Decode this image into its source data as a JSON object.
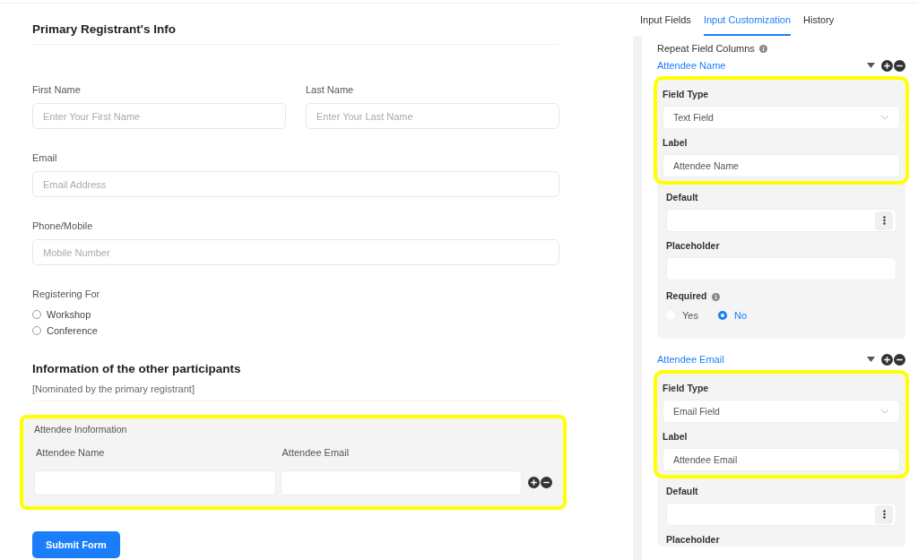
{
  "form": {
    "title": "Primary Registrant's Info",
    "name_fields": [
      {
        "label": "First Name",
        "placeholder": "Enter Your First Name"
      },
      {
        "label": "Last Name",
        "placeholder": "Enter Your Last Name"
      }
    ],
    "fields": [
      {
        "label": "Email",
        "placeholder": "Email Address"
      },
      {
        "label": "Phone/Mobile",
        "placeholder": "Mobile Number"
      }
    ],
    "radio_group": {
      "label": "Registering For",
      "options": [
        {
          "label": "Workshop",
          "selected": false
        },
        {
          "label": "Conference",
          "selected": false
        }
      ]
    },
    "participants": {
      "title": "Information of the other participants",
      "subtitle": "[Nominated by the primary registrant]",
      "repeater": {
        "title": "Attendee Inoformation",
        "highlighted": true,
        "columns": [
          {
            "label": "Attendee Name"
          },
          {
            "label": "Attendee Email"
          }
        ]
      }
    },
    "submit_button": "Submit Form"
  },
  "sidebar": {
    "tabs": [
      {
        "label": "Input Fields",
        "selected": false
      },
      {
        "label": "Input Customization",
        "selected": true
      },
      {
        "label": "History",
        "selected": false
      }
    ],
    "repeat_label": "Repeat Field Columns",
    "columns": [
      {
        "name": "Attendee Name",
        "highlighted": true,
        "field_type_label": "Field Type",
        "field_type": "Text Field",
        "label_label": "Label",
        "label_value": "Attendee Name",
        "default_label": "Default",
        "placeholder_label": "Placeholder",
        "required": {
          "label": "Required",
          "options": [
            {
              "label": "Yes",
              "selected": false
            },
            {
              "label": "No",
              "selected": true
            }
          ]
        }
      },
      {
        "name": "Attendee Email",
        "highlighted": true,
        "field_type_label": "Field Type",
        "field_type": "Email Field",
        "label_label": "Label",
        "label_value": "Attendee Email",
        "default_label": "Default",
        "placeholder_label": "Placeholder"
      }
    ]
  }
}
